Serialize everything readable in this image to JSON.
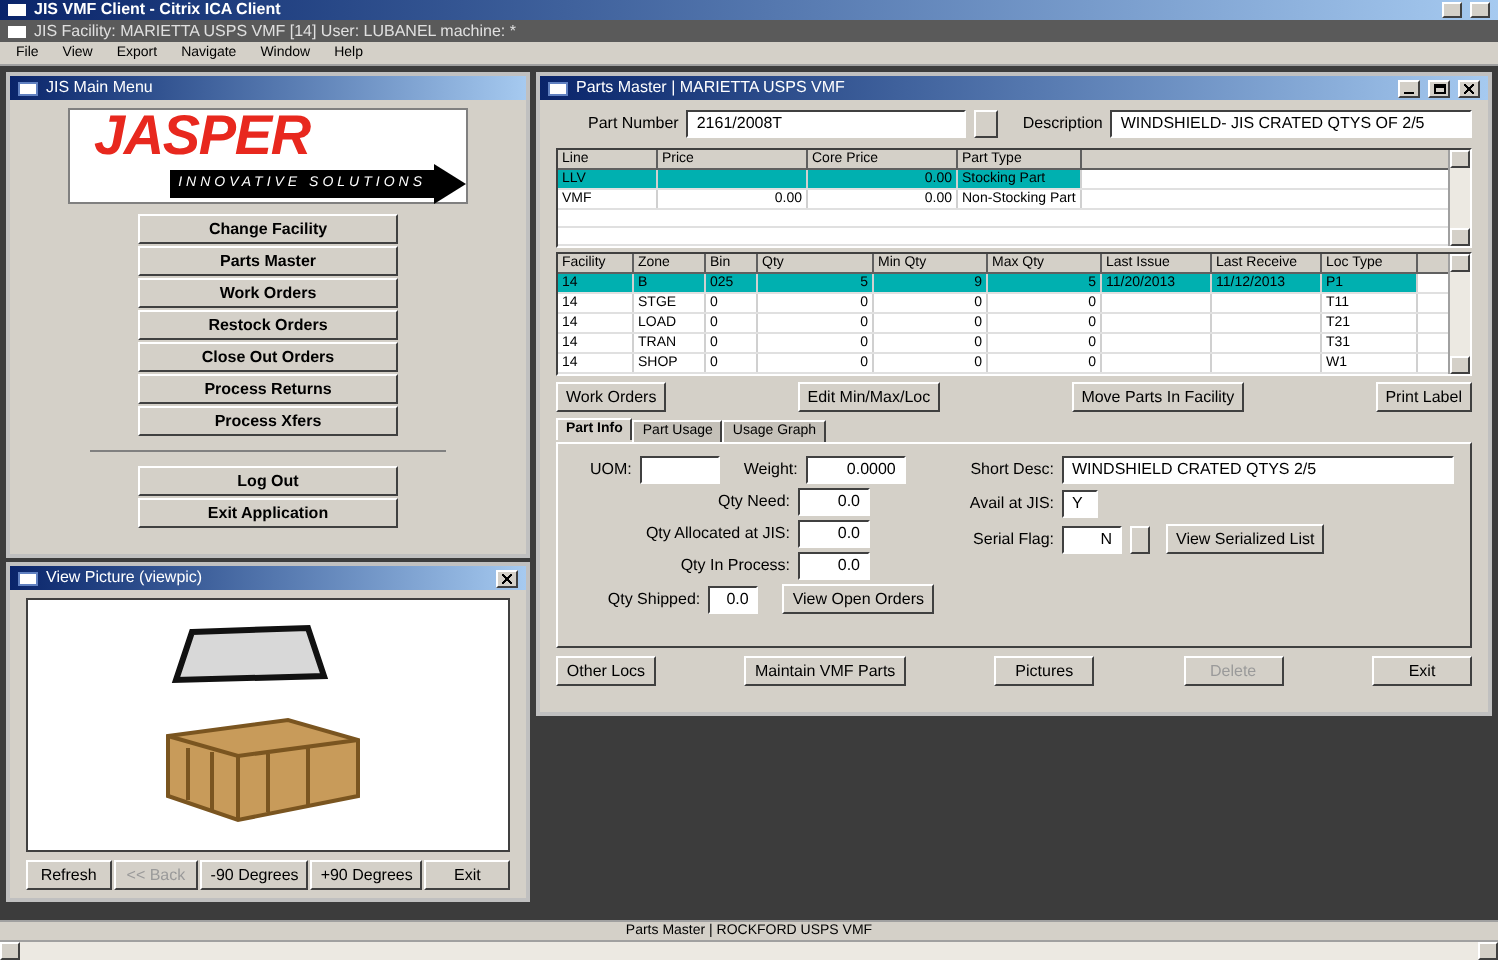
{
  "window": {
    "title": "JIS VMF Client - Citrix ICA Client"
  },
  "session_bar": {
    "title": "JIS Facility: MARIETTA USPS VMF [14] User: LUBANEL machine: *"
  },
  "menu": [
    "File",
    "View",
    "Export",
    "Navigate",
    "Window",
    "Help"
  ],
  "main_menu": {
    "title": "JIS Main Menu",
    "logo": {
      "name": "JASPER",
      "tagline": "INNOVATIVE SOLUTIONS"
    },
    "buttons": [
      "Change Facility",
      "Parts Master",
      "Work Orders",
      "Restock Orders",
      "Close Out Orders",
      "Process Returns",
      "Process Xfers"
    ],
    "footer_buttons": [
      "Log Out",
      "Exit Application"
    ]
  },
  "picture_window": {
    "title": "View Picture (viewpic)",
    "buttons": [
      {
        "label": "Refresh",
        "disabled": false
      },
      {
        "label": "<< Back",
        "disabled": true
      },
      {
        "label": "-90 Degrees",
        "disabled": false
      },
      {
        "label": "+90 Degrees",
        "disabled": false
      },
      {
        "label": "Exit",
        "disabled": false
      }
    ]
  },
  "parts_master": {
    "title": "Parts Master | MARIETTA USPS VMF",
    "part_number": {
      "label": "Part Number",
      "value": "2161/2008T"
    },
    "description": {
      "label": "Description",
      "value": "WINDSHIELD- JIS CRATED QTYS OF 2/5"
    },
    "lines_table": {
      "columns": [
        "Line",
        "Price",
        "Core Price",
        "Part Type"
      ],
      "rows": [
        {
          "cells": [
            "LLV",
            "",
            "0.00",
            "Stocking Part"
          ],
          "selected": true
        },
        {
          "cells": [
            "VMF",
            "0.00",
            "0.00",
            "Non-Stocking Part"
          ],
          "selected": false
        }
      ]
    },
    "locations_table": {
      "columns": [
        "Facility",
        "Zone",
        "Bin",
        "Qty",
        "Min Qty",
        "Max Qty",
        "Last Issue",
        "Last Receive",
        "Loc Type"
      ],
      "rows": [
        {
          "cells": [
            "14",
            "B",
            "025",
            "5",
            "9",
            "5",
            "11/20/2013",
            "11/12/2013",
            "P1"
          ],
          "selected": true
        },
        {
          "cells": [
            "14",
            "STGE",
            "0",
            "0",
            "0",
            "0",
            "",
            "",
            "T11"
          ],
          "selected": false
        },
        {
          "cells": [
            "14",
            "LOAD",
            "0",
            "0",
            "0",
            "0",
            "",
            "",
            "T21"
          ],
          "selected": false
        },
        {
          "cells": [
            "14",
            "TRAN",
            "0",
            "0",
            "0",
            "0",
            "",
            "",
            "T31"
          ],
          "selected": false
        },
        {
          "cells": [
            "14",
            "SHOP",
            "0",
            "0",
            "0",
            "0",
            "",
            "",
            "W1"
          ],
          "selected": false
        }
      ]
    },
    "action_buttons": [
      "Work Orders",
      "Edit Min/Max/Loc",
      "Move Parts In Facility",
      "Print Label"
    ],
    "tabs": [
      {
        "label": "Part Info",
        "selected": true
      },
      {
        "label": "Part Usage",
        "selected": false
      },
      {
        "label": "Usage Graph",
        "selected": false
      }
    ],
    "part_info": {
      "uom": {
        "label": "UOM:"
      },
      "weight": {
        "label": "Weight:",
        "value": "0.0000"
      },
      "short_desc": {
        "label": "Short Desc:",
        "value": "WINDSHIELD CRATED QTYS 2/5"
      },
      "avail": {
        "label": "Avail at JIS:",
        "value": "Y"
      },
      "serial_flag": {
        "label": "Serial Flag:",
        "value": "N"
      },
      "serial_button": "View Serialized List",
      "quantities": [
        {
          "label": "Qty Need:",
          "value": "0.0"
        },
        {
          "label": "Qty Allocated at JIS:",
          "value": "0.0"
        },
        {
          "label": "Qty In Process:",
          "value": "0.0"
        },
        {
          "label": "Qty Shipped:",
          "value": "0.0"
        }
      ],
      "orders_button": "View Open Orders"
    },
    "bottom_buttons": [
      {
        "label": "Other Locs",
        "disabled": false
      },
      {
        "label": "Maintain VMF Parts",
        "disabled": false
      },
      {
        "label": "Pictures",
        "disabled": false
      },
      {
        "label": "Delete",
        "disabled": true
      },
      {
        "label": "Exit",
        "disabled": false
      }
    ]
  },
  "status_bar": {
    "text": "Parts Master | ROCKFORD USPS VMF"
  }
}
